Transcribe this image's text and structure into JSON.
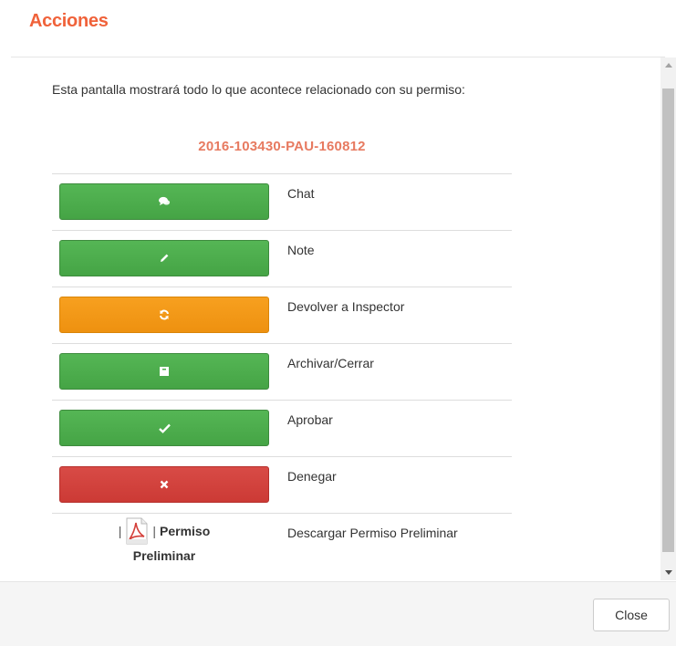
{
  "header": {
    "title": "Acciones"
  },
  "body": {
    "intro": "Esta pantalla mostrará todo lo que acontece relacionado con su permiso:",
    "permit_number": "2016-103430-PAU-160812",
    "actions": [
      {
        "label": "Chat",
        "button_color": "green",
        "icon": "comment-icon"
      },
      {
        "label": "Note",
        "button_color": "green",
        "icon": "pencil-icon"
      },
      {
        "label": "Devolver a Inspector",
        "button_color": "orange",
        "icon": "refresh-icon"
      },
      {
        "label": "Archivar/Cerrar",
        "button_color": "green",
        "icon": "archive-icon"
      },
      {
        "label": "Aprobar",
        "button_color": "green",
        "icon": "checkmark-icon"
      },
      {
        "label": "Denegar",
        "button_color": "red",
        "icon": "x-icon"
      }
    ],
    "download": {
      "separator_left": "|",
      "separator_right": "|",
      "link_line1": "Permiso",
      "link_line2": "Preliminar",
      "label": "Descargar Permiso Preliminar",
      "icon": "pdf-icon"
    }
  },
  "footer": {
    "close_label": "Close"
  },
  "colors": {
    "title": "#f0623a",
    "permit_number": "#e77a60",
    "green": "#4cae4c",
    "orange": "#f0961a",
    "red": "#d2413c"
  }
}
